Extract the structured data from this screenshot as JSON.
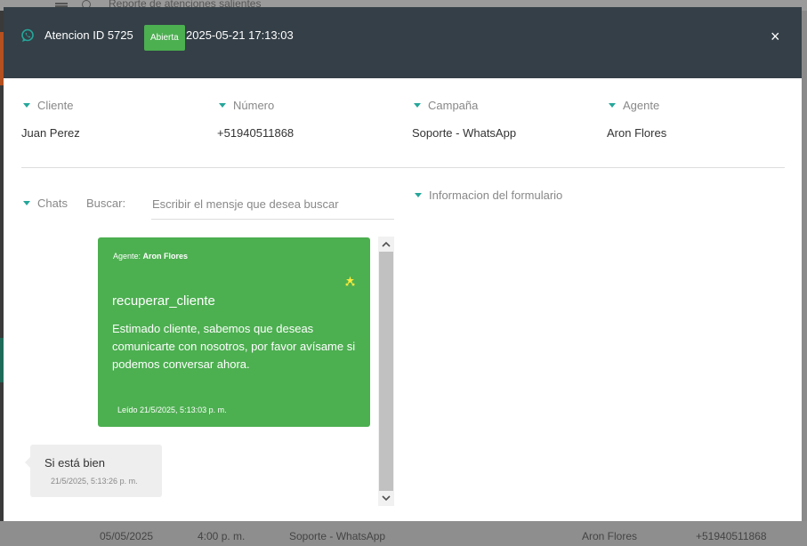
{
  "background": {
    "title": "Reporte de atenciones salientes",
    "bottom_row": [
      "05/05/2025",
      "4:00 p. m.",
      "Soporte - WhatsApp",
      "Aron Flores",
      "+51940511868"
    ]
  },
  "header": {
    "title": "Atencion ID 5725",
    "status": "Abierta",
    "datetime": "2025-05-21 17:13:03",
    "close": "×",
    "colors": {
      "bar": "#343f47",
      "badge": "#4caf50"
    }
  },
  "info": {
    "cliente": {
      "label": "Cliente",
      "value": "Juan Perez"
    },
    "numero": {
      "label": "Número",
      "value": "+51940511868"
    },
    "campana": {
      "label": "Campaña",
      "value": "Soporte - WhatsApp"
    },
    "agente": {
      "label": "Agente",
      "value": "Aron Flores"
    }
  },
  "chats": {
    "label": "Chats",
    "search_label": "Buscar:",
    "search_placeholder": "Escribir el mensje que desea buscar",
    "search_value": ""
  },
  "form": {
    "label": "Informacion del formulario"
  },
  "messages": {
    "agent": {
      "prefix": "Agente:",
      "name": "Aron Flores",
      "template": "recuperar_cliente",
      "text": "Estimado cliente, sabemos que deseas comunicarte con nosotros, por favor avísame si podemos conversar ahora.",
      "status": "Leído 21/5/2025, 5:13:03 p. m.",
      "icon": "sparkle-icon",
      "color": "#4caf50"
    },
    "client": {
      "text": "Si está bien",
      "time": "21/5/2025, 5:13:26 p. m.",
      "color": "#eeeeee"
    }
  }
}
